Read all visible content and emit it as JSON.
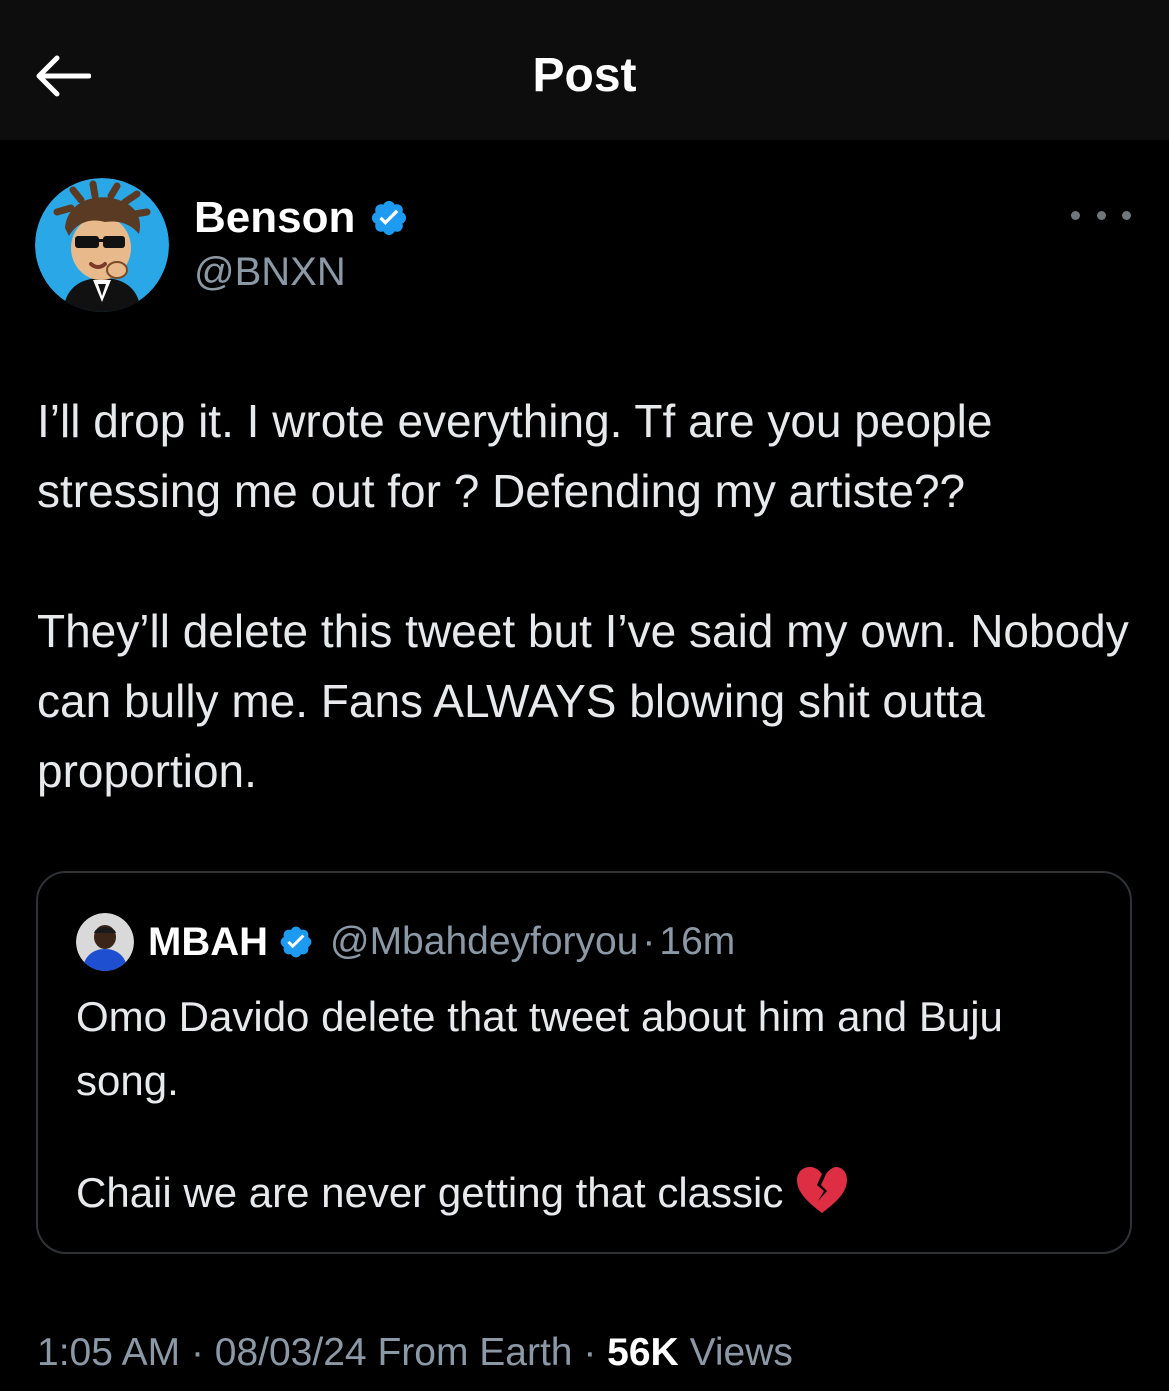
{
  "header": {
    "title": "Post"
  },
  "post": {
    "author": {
      "name": "Benson",
      "handle": "@BNXN",
      "verified": true
    },
    "paragraphs": [
      "I’ll drop it. I wrote everything. Tf are you people stressing me out for ? Defending my artiste??",
      "They’ll delete this tweet but I’ve said my own. Nobody can bully me. Fans ALWAYS blowing shit outta proportion."
    ],
    "quoted": {
      "name": "MBAH",
      "handle": "@Mbahdeyforyou",
      "separator": "·",
      "time": "16m",
      "verified": true,
      "paragraphs": [
        "Omo Davido delete that tweet about him and Buju song.",
        "Chaii we are never getting that classic"
      ],
      "emoji": "broken-heart"
    },
    "meta": {
      "time": "1:05 AM",
      "date": "08/03/24",
      "source": "From Earth",
      "views_count": "56K",
      "views_label": "Views",
      "separator": "·"
    }
  },
  "colors": {
    "background": "#000000",
    "header_bg": "#0d0d0d",
    "text": "#e7e9ea",
    "secondary": "#8b98a5",
    "verified": "#1d9bf0",
    "border": "#2f3336"
  }
}
